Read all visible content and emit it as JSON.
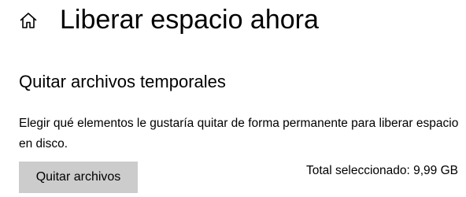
{
  "header": {
    "home_icon": "home-icon",
    "title": "Liberar espacio ahora"
  },
  "section": {
    "title": "Quitar archivos temporales",
    "description": "Elegir qué elementos le gustaría quitar de forma permanente para liberar espacio en disco.",
    "button_label": "Quitar archivos",
    "total_label": "Total seleccionado: 9,99 GB"
  },
  "colors": {
    "background": "#ffffff",
    "button_background": "#cccccc",
    "text": "#000000"
  }
}
